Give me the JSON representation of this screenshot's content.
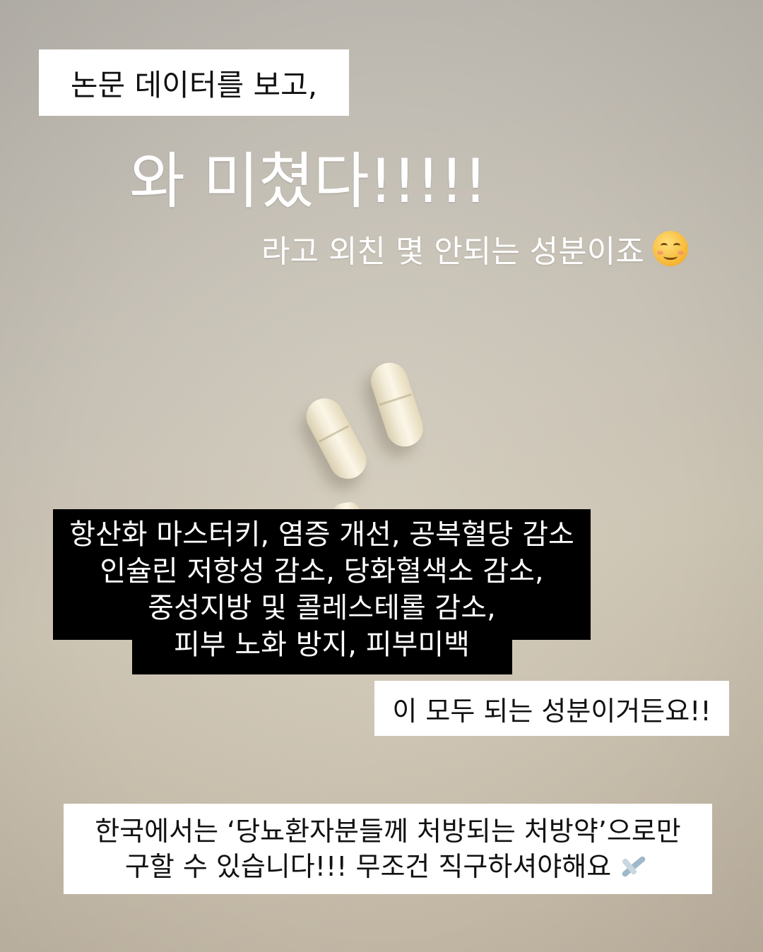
{
  "title": "논문 데이터를 보고,",
  "exclaim": "와 미쳤다!!!!!",
  "subline": "라고 외친 몇 안되는 성분이죠",
  "benefits": [
    "항산화 마스터키, 염증 개선, 공복혈당 감소",
    "인슐린 저항성 감소, 당화혈색소 감소,",
    "중성지방 및 콜레스테롤 감소,",
    "피부 노화 방지, 피부미백"
  ],
  "claim": "이 모두 되는 성분이거든요!!",
  "korea_note": [
    "한국에서는 ‘당뇨환자분들께 처방되는 처방약’으로만",
    "구할 수 있습니다!!! 무조건 직구하셔야해요"
  ],
  "icons": {
    "subline_emoji": "smiling-face-icon",
    "note_emoji": "airplane-icon"
  }
}
